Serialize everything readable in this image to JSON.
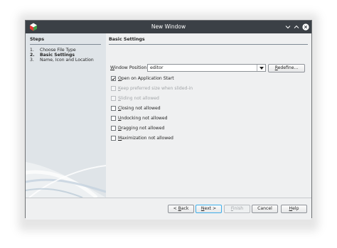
{
  "window": {
    "title": "New Window"
  },
  "steps": {
    "heading": "Steps",
    "items": [
      {
        "num": "1.",
        "label": "Choose File Type",
        "current": false
      },
      {
        "num": "2.",
        "label": "Basic Settings",
        "current": true
      },
      {
        "num": "3.",
        "label": "Name, Icon and Location",
        "current": false
      }
    ]
  },
  "basic": {
    "heading": "Basic Settings",
    "window_position": {
      "label_first": "W",
      "label_rest": "indow Position :",
      "value": "editor"
    },
    "redefine": {
      "first": "R",
      "rest": "edefine..."
    },
    "options": [
      {
        "first": "O",
        "rest": "pen on Application Start",
        "checked": true,
        "enabled": true
      },
      {
        "first": "K",
        "rest": "eep preferred size when slided-in",
        "checked": false,
        "enabled": false
      },
      {
        "first": "S",
        "rest": "liding not allowed",
        "checked": false,
        "enabled": false
      },
      {
        "first": "C",
        "rest": "losing not allowed",
        "checked": false,
        "enabled": true
      },
      {
        "first": "U",
        "rest": "ndocking not allowed",
        "checked": false,
        "enabled": true
      },
      {
        "first": "D",
        "rest": "ragging not allowed",
        "checked": false,
        "enabled": true
      },
      {
        "first": "M",
        "rest": "aximization not allowed",
        "checked": false,
        "enabled": true
      }
    ]
  },
  "buttons": {
    "back": {
      "prefix": "< ",
      "first": "B",
      "rest": "ack"
    },
    "next": {
      "first": "N",
      "rest": "ext >"
    },
    "finish": {
      "first": "F",
      "rest": "inish"
    },
    "cancel": "Cancel",
    "help": {
      "first": "H",
      "rest": "elp"
    }
  },
  "colors": {
    "titlebar": "#3b4046",
    "accent": "#3daee9",
    "steps_panel": "#dfe4e8"
  }
}
